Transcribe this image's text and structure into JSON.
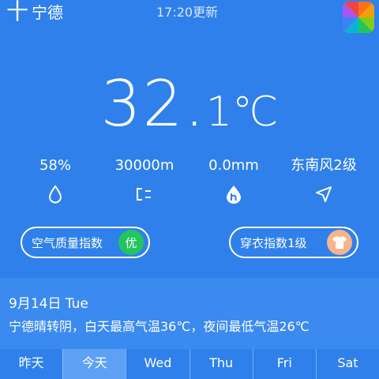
{
  "header": {
    "add_symbol": "十",
    "city": "宁德",
    "updated": "17:20更新"
  },
  "current": {
    "temp_integer": "32.",
    "temp_decimal": "1℃"
  },
  "stats": [
    {
      "value": "58%",
      "icon": "humidity-drop-icon"
    },
    {
      "value": "30000m",
      "icon": "visibility-icon"
    },
    {
      "value": "0.0mm",
      "icon": "precipitation-icon"
    },
    {
      "value": "东南风2级",
      "icon": "wind-direction-icon"
    }
  ],
  "air_quality": {
    "label": "空气质量指数",
    "badge": "优",
    "badge_color": "#22c55e"
  },
  "clothing": {
    "label": "穿衣指数1级",
    "badge_color": "#f8b48a"
  },
  "forecast": {
    "date": "9月14日 Tue",
    "description": "宁德晴转阴，白天最高气温36℃，夜间最低气温26℃"
  },
  "tabs": [
    "昨天",
    "今天",
    "Wed",
    "Thu",
    "Fri",
    "Sat"
  ],
  "active_tab_index": 1,
  "colors": {
    "background": "#2f80ea",
    "info_panel": "#3b8af0",
    "active_tab": "#5ea1f4"
  }
}
